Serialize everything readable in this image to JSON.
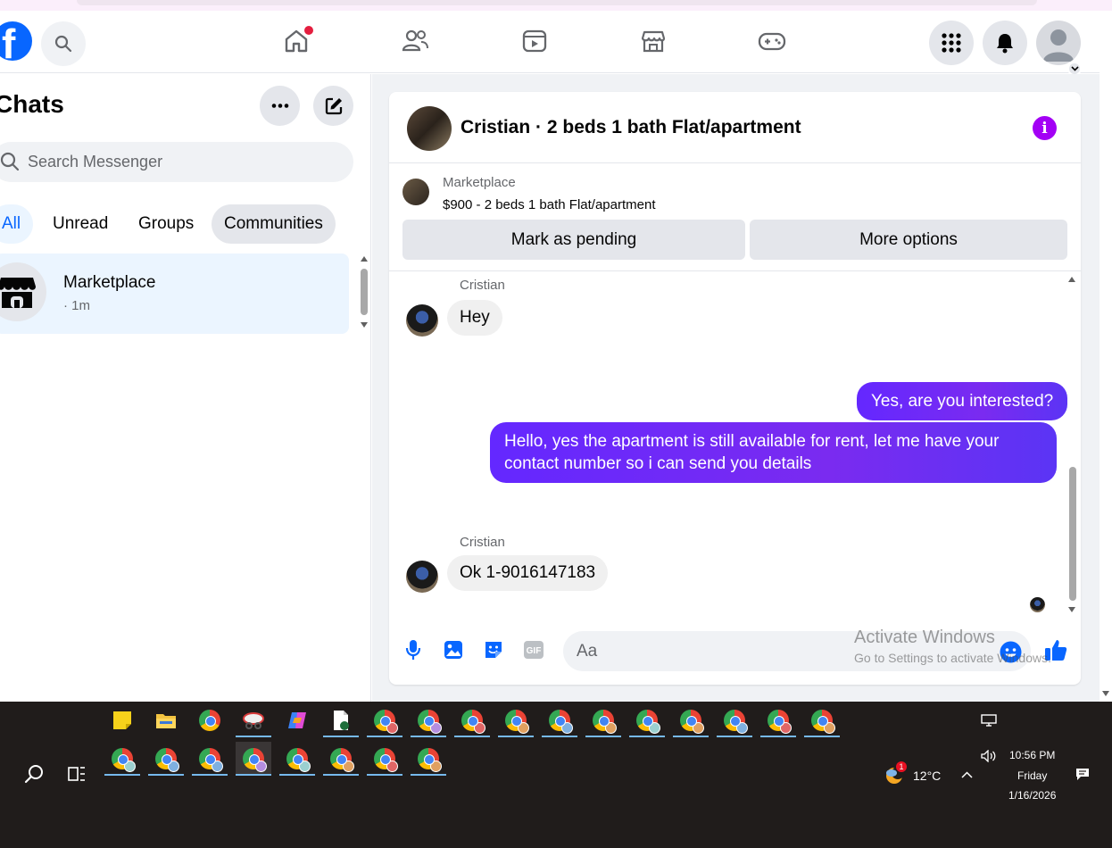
{
  "nav": {
    "logo": "f",
    "tabs": [
      "home-icon",
      "friends-icon",
      "video-icon",
      "marketplace-icon",
      "gaming-icon"
    ]
  },
  "chats": {
    "title": "Chats",
    "search_placeholder": "Search Messenger",
    "filters": [
      "All",
      "Unread",
      "Groups",
      "Communities"
    ],
    "items": [
      {
        "name": "Marketplace",
        "time": "· 1m"
      }
    ]
  },
  "conversation": {
    "title": "Cristian · 2 beds 1 bath Flat/apartment",
    "marketplace_label": "Marketplace",
    "listing": "$900 - 2 beds 1 bath Flat/apartment",
    "mark_pending": "Mark as pending",
    "more_options": "More options",
    "messages": [
      {
        "sender": "Cristian",
        "text": "Hey",
        "direction": "in"
      },
      {
        "text": "Yes, are you interested?",
        "direction": "out"
      },
      {
        "text": "Hello, yes the apartment is still available for rent, let me have your contact number so i can send you details",
        "direction": "out"
      },
      {
        "sender": "Cristian",
        "text": "Ok 1-9016147183",
        "direction": "in"
      }
    ],
    "composer_placeholder": "Aa",
    "gif_label": "GIF"
  },
  "watermark": {
    "line1": "Activate Windows",
    "line2": "Go to Settings to activate Windows."
  },
  "taskbar": {
    "weather_temp": "12°C",
    "weather_badge": "1",
    "time": "10:56 PM",
    "day": "Friday",
    "date": "1/16/2026"
  },
  "colors": {
    "brand": "#0866ff",
    "outgoing_bubble": "#6428ff",
    "info": "#a300f5",
    "taskbar": "#201c1b"
  }
}
